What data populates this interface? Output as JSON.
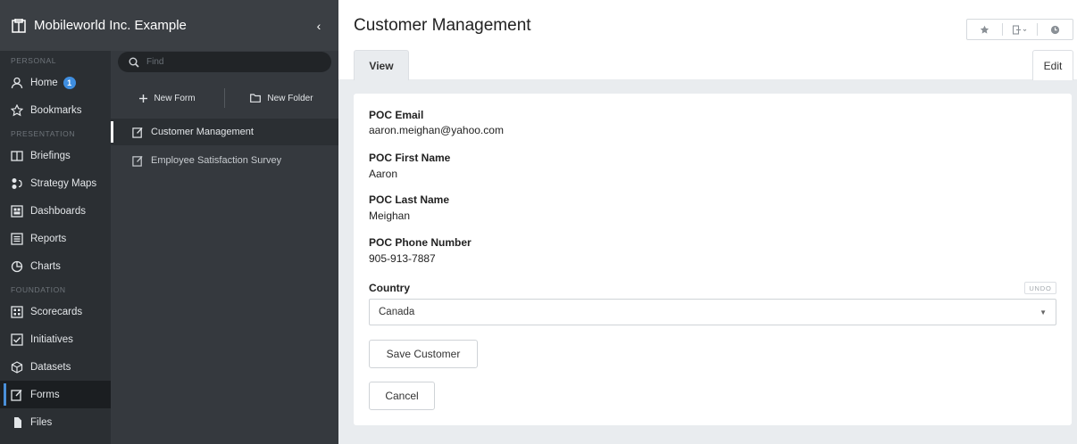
{
  "org": {
    "name": "Mobileworld Inc. Example",
    "collapse_glyph": "‹"
  },
  "nav": {
    "sections": [
      "PERSONAL",
      "PRESENTATION",
      "FOUNDATION"
    ],
    "personal": [
      {
        "label": "Home",
        "icon": "user-icon",
        "badge": "1"
      },
      {
        "label": "Bookmarks",
        "icon": "star-icon"
      }
    ],
    "presentation": [
      {
        "label": "Briefings",
        "icon": "book-icon"
      },
      {
        "label": "Strategy Maps",
        "icon": "strategy-map-icon"
      },
      {
        "label": "Dashboards",
        "icon": "dashboard-icon"
      },
      {
        "label": "Reports",
        "icon": "report-icon"
      },
      {
        "label": "Charts",
        "icon": "pie-chart-icon"
      }
    ],
    "foundation": [
      {
        "label": "Scorecards",
        "icon": "scorecard-icon"
      },
      {
        "label": "Initiatives",
        "icon": "checkbox-icon"
      },
      {
        "label": "Datasets",
        "icon": "cube-icon"
      },
      {
        "label": "Forms",
        "icon": "form-icon",
        "active": true
      },
      {
        "label": "Files",
        "icon": "file-icon"
      }
    ]
  },
  "subpanel": {
    "search_placeholder": "Find",
    "new_form_label": "New Form",
    "new_folder_label": "New Folder",
    "items": [
      {
        "label": "Customer Management",
        "selected": true
      },
      {
        "label": "Employee Satisfaction Survey"
      }
    ]
  },
  "content": {
    "title": "Customer Management",
    "tabs": {
      "view": "View",
      "edit": "Edit"
    },
    "fields": [
      {
        "label": "POC Email",
        "value": "aaron.meighan@yahoo.com"
      },
      {
        "label": "POC First Name",
        "value": "Aaron"
      },
      {
        "label": "POC Last Name",
        "value": "Meighan"
      },
      {
        "label": "POC Phone Number",
        "value": "905-913-7887"
      }
    ],
    "country": {
      "label": "Country",
      "value": "Canada",
      "undo_label": "UNDO"
    },
    "save_label": "Save Customer",
    "cancel_label": "Cancel"
  },
  "colors": {
    "sidebar": "#2b2f33",
    "subpanel": "#35393e",
    "accent": "#3f8ee0",
    "background": "#e9ecef"
  }
}
